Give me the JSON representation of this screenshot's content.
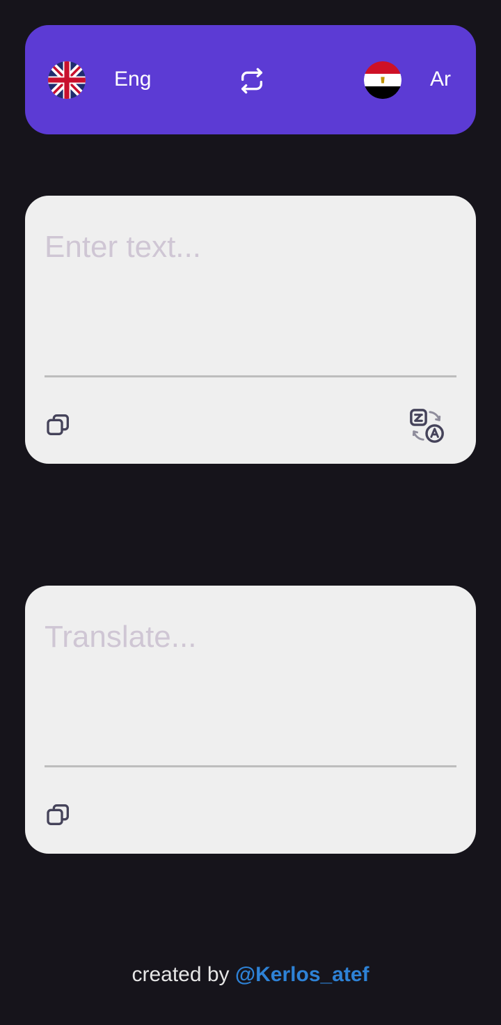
{
  "language_bar": {
    "source": {
      "label": "Eng",
      "flag_icon": "uk-flag-icon"
    },
    "swap_icon": "swap-arrows-icon",
    "target": {
      "label": "Ar",
      "flag_icon": "egypt-flag-icon"
    },
    "background_color": "#5c3bd4"
  },
  "input_card": {
    "placeholder": "Enter text...",
    "value": "",
    "copy_icon": "copy-icon",
    "translate_icon": "translate-icon"
  },
  "output_card": {
    "placeholder": "Translate...",
    "value": "",
    "copy_icon": "copy-icon"
  },
  "footer": {
    "prefix": "created by ",
    "handle": "@Kerlos_atef",
    "handle_color": "#2e82d6"
  },
  "colors": {
    "background": "#16141b",
    "card": "#efefef",
    "placeholder": "#cfc6d4"
  }
}
